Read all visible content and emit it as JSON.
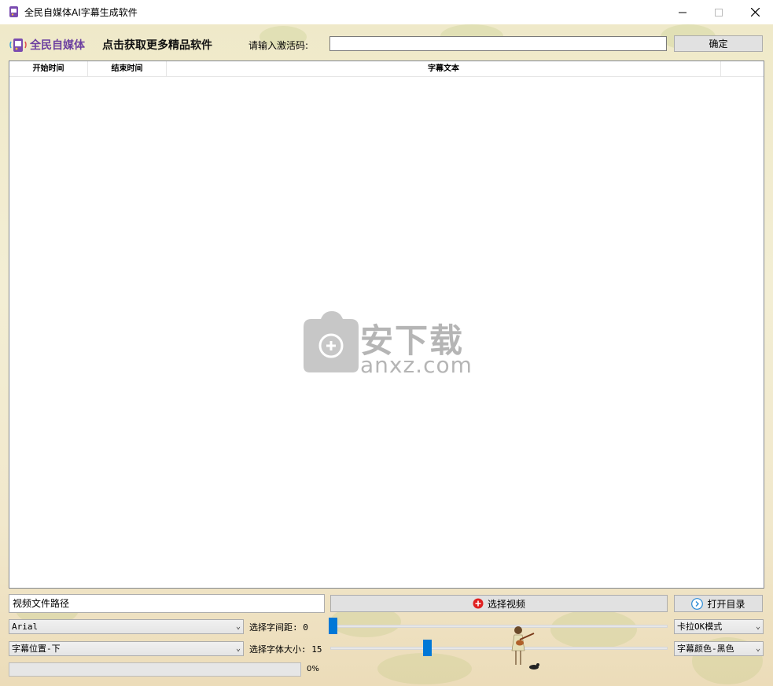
{
  "window": {
    "title": "全民自媒体AI字幕生成软件"
  },
  "header": {
    "brand": "全民自媒体",
    "promo_link": "点击获取更多精品软件",
    "activation_label": "请输入激活码:",
    "activation_value": "",
    "confirm_button": "确定"
  },
  "table": {
    "columns": [
      "开始时间",
      "结束时间",
      "字幕文本"
    ],
    "rows": []
  },
  "watermark": {
    "cn": "安下载",
    "en": "anxz.com"
  },
  "controls": {
    "video_path": "视频文件路径",
    "select_video_button": "选择视频",
    "open_dir_button": "打开目录",
    "font_select": "Arial",
    "spacing_label": "选择字间距: 0",
    "spacing_value": 0,
    "mode_select": "卡拉OK模式",
    "position_select": "字幕位置-下",
    "size_label": "选择字体大小: 15",
    "size_value": 15,
    "color_select": "字幕颜色-黑色",
    "progress_percent": 0,
    "progress_text": "0%"
  },
  "colors": {
    "accent": "#0078d7",
    "brand": "#6c3fa0",
    "record_icon": "#e02020"
  },
  "icons": {
    "app": "app-icon",
    "minimize": "minimize-icon",
    "maximize": "maximize-icon",
    "close": "close-icon",
    "record": "record-icon",
    "open_dir": "chevron-circle-icon",
    "dropdown": "chevron-down-icon"
  }
}
